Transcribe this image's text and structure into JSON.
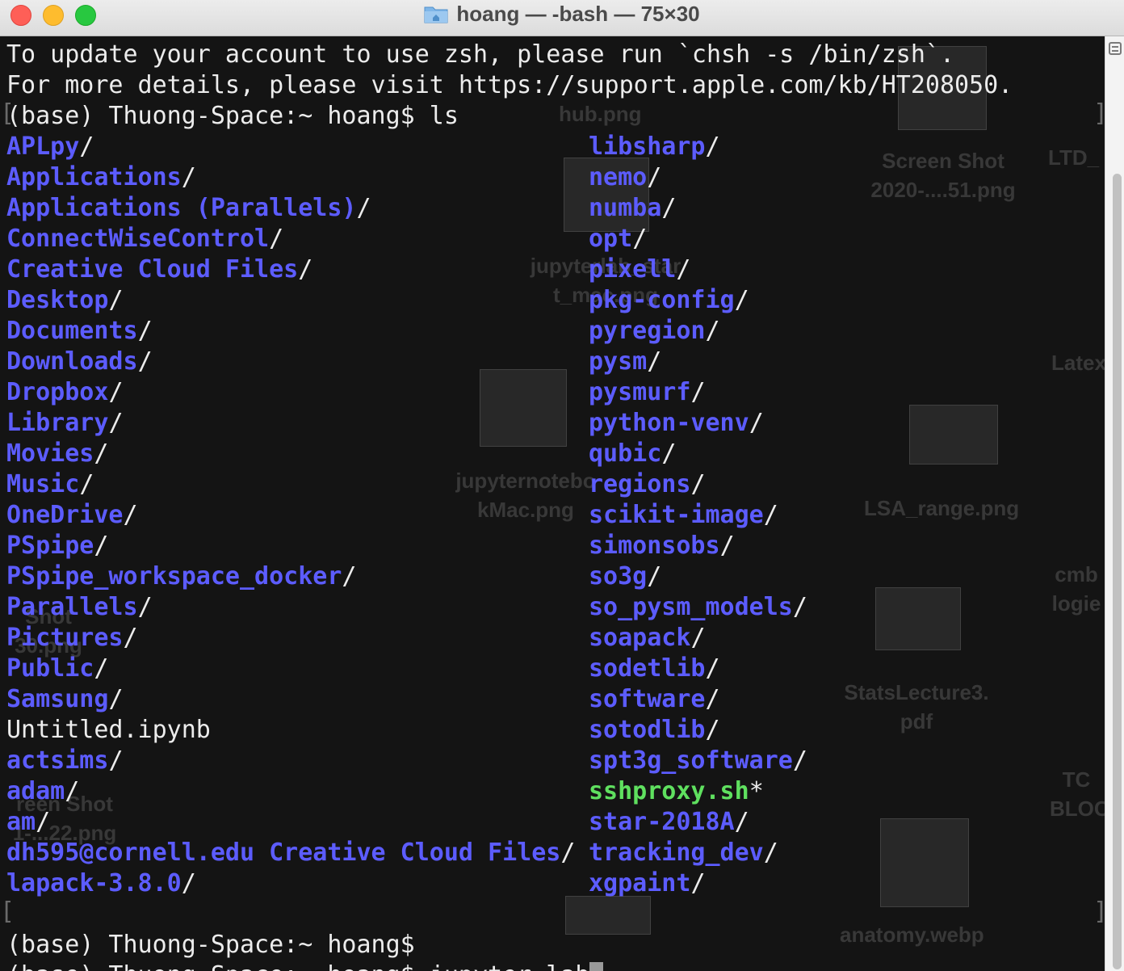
{
  "window": {
    "title": "hoang — -bash — 75×30",
    "folder_icon": "folder-icon"
  },
  "terminal": {
    "header_lines": [
      "To update your account to use zsh, please run `chsh -s /bin/zsh`.",
      "For more details, please visit https://support.apple.com/kb/HT208050.",
      "(base) Thuong-Space:~ hoang$ ls"
    ],
    "left_entries": [
      {
        "name": "APLpy",
        "suffix": "/",
        "kind": "dir"
      },
      {
        "name": "Applications",
        "suffix": "/",
        "kind": "dir"
      },
      {
        "name": "Applications (Parallels)",
        "suffix": "/",
        "kind": "dir"
      },
      {
        "name": "ConnectWiseControl",
        "suffix": "/",
        "kind": "dir"
      },
      {
        "name": "Creative Cloud Files",
        "suffix": "/",
        "kind": "dir"
      },
      {
        "name": "Desktop",
        "suffix": "/",
        "kind": "dir"
      },
      {
        "name": "Documents",
        "suffix": "/",
        "kind": "dir"
      },
      {
        "name": "Downloads",
        "suffix": "/",
        "kind": "dir"
      },
      {
        "name": "Dropbox",
        "suffix": "/",
        "kind": "dir"
      },
      {
        "name": "Library",
        "suffix": "/",
        "kind": "dir"
      },
      {
        "name": "Movies",
        "suffix": "/",
        "kind": "dir"
      },
      {
        "name": "Music",
        "suffix": "/",
        "kind": "dir"
      },
      {
        "name": "OneDrive",
        "suffix": "/",
        "kind": "dir"
      },
      {
        "name": "PSpipe",
        "suffix": "/",
        "kind": "dir"
      },
      {
        "name": "PSpipe_workspace_docker",
        "suffix": "/",
        "kind": "dir"
      },
      {
        "name": "Parallels",
        "suffix": "/",
        "kind": "dir"
      },
      {
        "name": "Pictures",
        "suffix": "/",
        "kind": "dir"
      },
      {
        "name": "Public",
        "suffix": "/",
        "kind": "dir"
      },
      {
        "name": "Samsung",
        "suffix": "/",
        "kind": "dir"
      },
      {
        "name": "Untitled.ipynb",
        "suffix": "",
        "kind": "file"
      },
      {
        "name": "actsims",
        "suffix": "/",
        "kind": "dir"
      },
      {
        "name": "adam",
        "suffix": "/",
        "kind": "dir"
      },
      {
        "name": "am",
        "suffix": "/",
        "kind": "dir"
      },
      {
        "name": "dh595@cornell.edu Creative Cloud Files",
        "suffix": "/",
        "kind": "dir"
      },
      {
        "name": "lapack-3.8.0",
        "suffix": "/",
        "kind": "dir"
      }
    ],
    "right_entries": [
      {
        "name": "libsharp",
        "suffix": "/",
        "kind": "dir"
      },
      {
        "name": "nemo",
        "suffix": "/",
        "kind": "dir"
      },
      {
        "name": "numba",
        "suffix": "/",
        "kind": "dir"
      },
      {
        "name": "opt",
        "suffix": "/",
        "kind": "dir"
      },
      {
        "name": "pixell",
        "suffix": "/",
        "kind": "dir"
      },
      {
        "name": "pkg-config",
        "suffix": "/",
        "kind": "dir"
      },
      {
        "name": "pyregion",
        "suffix": "/",
        "kind": "dir"
      },
      {
        "name": "pysm",
        "suffix": "/",
        "kind": "dir"
      },
      {
        "name": "pysmurf",
        "suffix": "/",
        "kind": "dir"
      },
      {
        "name": "python-venv",
        "suffix": "/",
        "kind": "dir"
      },
      {
        "name": "qubic",
        "suffix": "/",
        "kind": "dir"
      },
      {
        "name": "regions",
        "suffix": "/",
        "kind": "dir"
      },
      {
        "name": "scikit-image",
        "suffix": "/",
        "kind": "dir"
      },
      {
        "name": "simonsobs",
        "suffix": "/",
        "kind": "dir"
      },
      {
        "name": "so3g",
        "suffix": "/",
        "kind": "dir"
      },
      {
        "name": "so_pysm_models",
        "suffix": "/",
        "kind": "dir"
      },
      {
        "name": "soapack",
        "suffix": "/",
        "kind": "dir"
      },
      {
        "name": "sodetlib",
        "suffix": "/",
        "kind": "dir"
      },
      {
        "name": "software",
        "suffix": "/",
        "kind": "dir"
      },
      {
        "name": "sotodlib",
        "suffix": "/",
        "kind": "dir"
      },
      {
        "name": "spt3g_software",
        "suffix": "/",
        "kind": "dir"
      },
      {
        "name": "sshproxy.sh",
        "suffix": "*",
        "kind": "exec"
      },
      {
        "name": "star-2018A",
        "suffix": "/",
        "kind": "dir"
      },
      {
        "name": "tracking_dev",
        "suffix": "/",
        "kind": "dir"
      },
      {
        "name": "xgpaint",
        "suffix": "/",
        "kind": "dir"
      }
    ],
    "prompt_line": "(base) Thuong-Space:~ hoang$",
    "input_line": "(base) Thuong-Space:~ hoang$ jupyter lab"
  },
  "desktop_ghost_labels": [
    "hub.png",
    "Screen Shot 2020-....51.png",
    "LTD_",
    "jupyterlab_star t_mac.png",
    "Latex",
    "jupyternotebo kMac.png",
    "LSA_range.png",
    "cmb logie",
    "StatsLecture3. pdf",
    "TC BLOC",
    "anatomy.webp",
    "Shot 30.png",
    "reen Shot 1-...22.png"
  ],
  "colors": {
    "directory": "#5c5cff",
    "executable": "#5fe05f",
    "text": "#ececec",
    "background": "#141414"
  }
}
